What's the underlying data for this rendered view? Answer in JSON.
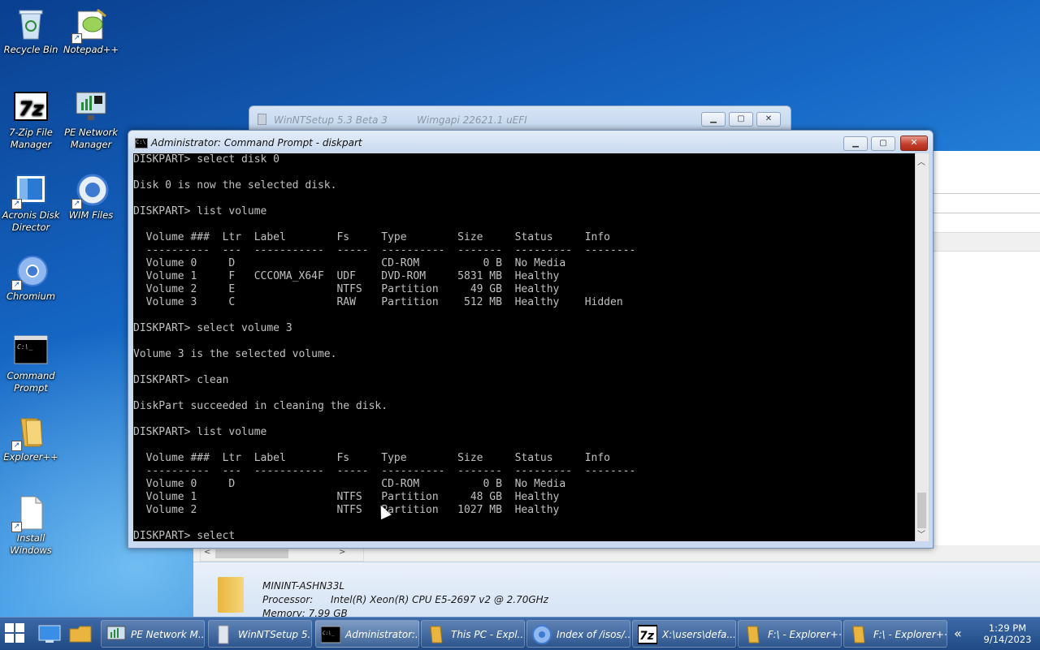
{
  "desktop": {
    "icons": [
      {
        "label": "Recycle Bin",
        "icon": "recycle-bin-icon"
      },
      {
        "label": "Notepad++",
        "icon": "notepad-plus-icon"
      },
      {
        "label": "7-Zip File Manager",
        "icon": "seven-zip-icon"
      },
      {
        "label": "PE Network Manager",
        "icon": "network-manager-icon"
      },
      {
        "label": "Acronis Disk Director",
        "icon": "acronis-icon"
      },
      {
        "label": "WIM Files",
        "icon": "wim-files-icon"
      },
      {
        "label": "Chromium",
        "icon": "chromium-icon"
      },
      {
        "label": "Command Prompt",
        "icon": "command-prompt-icon"
      },
      {
        "label": "Explorer++",
        "icon": "explorer-plus-icon"
      },
      {
        "label": "Install Windows",
        "icon": "install-windows-icon"
      }
    ]
  },
  "background_window": {
    "title": "WinNTSetup 5.3 Beta 3",
    "subtitle": "Wimgapi 22621.1  uEFI"
  },
  "cmd_window": {
    "title": "Administrator: Command Prompt - diskpart",
    "console_lines": [
      "DISKPART> select disk 0",
      "",
      "Disk 0 is now the selected disk.",
      "",
      "DISKPART> list volume",
      "",
      "  Volume ###  Ltr  Label        Fs     Type        Size     Status     Info",
      "  ----------  ---  -----------  -----  ----------  -------  ---------  --------",
      "  Volume 0     D                       CD-ROM          0 B  No Media",
      "  Volume 1     F   CCCOMA_X64F  UDF    DVD-ROM     5831 MB  Healthy",
      "  Volume 2     E                NTFS   Partition     49 GB  Healthy",
      "  Volume 3     C                RAW    Partition    512 MB  Healthy    Hidden",
      "",
      "DISKPART> select volume 3",
      "",
      "Volume 3 is the selected volume.",
      "",
      "DISKPART> clean",
      "",
      "DiskPart succeeded in cleaning the disk.",
      "",
      "DISKPART> list volume",
      "",
      "  Volume ###  Ltr  Label        Fs     Type        Size     Status     Info",
      "  ----------  ---  -----------  -----  ----------  -------  ---------  --------",
      "  Volume 0     D                       CD-ROM          0 B  No Media",
      "  Volume 1                      NTFS   Partition     48 GB  Healthy",
      "  Volume 2                      NTFS   Partition   1027 MB  Healthy",
      "",
      "DISKPART> select"
    ]
  },
  "explorer_details": {
    "computer_name": "MININT-ASHN33L",
    "processor_label": "Processor:",
    "processor_value": "Intel(R) Xeon(R) CPU E5-2697 v2 @ 2.70GHz",
    "memory": "Memory: 7.99 GB"
  },
  "taskbar": {
    "items": [
      {
        "label": "PE Network M...",
        "icon": "network-manager-icon"
      },
      {
        "label": "WinNTSetup 5...",
        "icon": "winntsetup-icon"
      },
      {
        "label": "Administrator:...",
        "icon": "command-prompt-icon"
      },
      {
        "label": "This PC - Expl...",
        "icon": "folder-icon"
      },
      {
        "label": "Index of /isos/...",
        "icon": "chromium-icon"
      },
      {
        "label": "X:\\users\\defa...",
        "icon": "seven-zip-icon"
      },
      {
        "label": "F:\\ - Explorer++",
        "icon": "folder-icon"
      },
      {
        "label": "F:\\ - Explorer++",
        "icon": "folder-icon"
      }
    ],
    "clock_time": "1:29 PM",
    "clock_date": "9/14/2023"
  }
}
